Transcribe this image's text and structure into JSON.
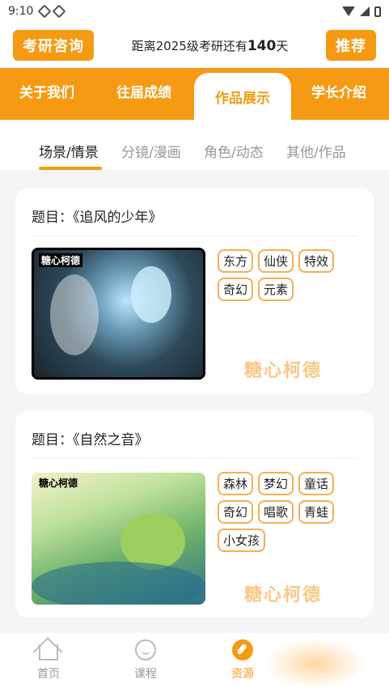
{
  "status": {
    "time": "9:10"
  },
  "header": {
    "consult_label": "考研咨询",
    "countdown_prefix": "距离2025级考研还有",
    "countdown_days": "140",
    "countdown_suffix": "天",
    "recommend_label": "推荐"
  },
  "tabs": [
    "关于我们",
    "往届成绩",
    "作品展示",
    "学长介绍"
  ],
  "subtabs": [
    "场景/情景",
    "分镜/漫画",
    "角色/动态",
    "其他/作品"
  ],
  "works": [
    {
      "title": "题目：《追风的少年》",
      "thumb_logo": "糖心柯德",
      "tags": [
        "东方",
        "仙侠",
        "特效",
        "奇幻",
        "元素"
      ],
      "watermark": "糖心柯德"
    },
    {
      "title": "题目：《自然之音》",
      "thumb_logo": "糖心柯德",
      "tags": [
        "森林",
        "梦幻",
        "童话",
        "奇幻",
        "唱歌",
        "青蛙",
        "小女孩"
      ],
      "watermark": "糖心柯德"
    }
  ],
  "bottom_nav": [
    "首页",
    "课程",
    "资源"
  ],
  "colors": {
    "accent": "#f59a12"
  }
}
